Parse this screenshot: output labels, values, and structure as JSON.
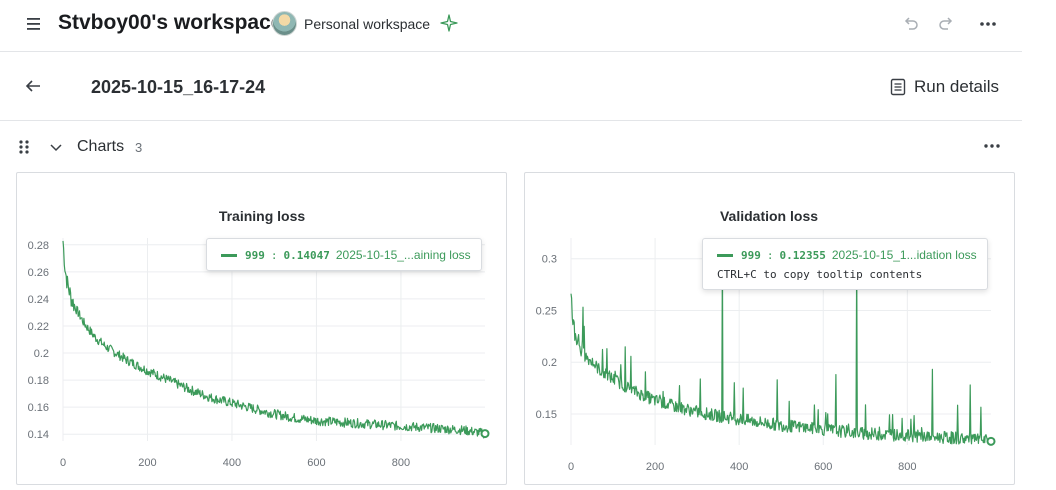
{
  "header": {
    "workspace_title": "Stvboy00's workspace",
    "workspace_name": "Personal workspace"
  },
  "run": {
    "name": "2025-10-15_16-17-24",
    "details_label": "Run details"
  },
  "section": {
    "title": "Charts",
    "count": "3"
  },
  "colors": {
    "series": "#3c9a5a",
    "grid": "#eceef0",
    "axis": "#6b7178"
  },
  "charts": [
    {
      "title": "Training loss",
      "tooltip": {
        "step": "999",
        "value": "0.14047",
        "label": "2025-10-15_...aining loss"
      }
    },
    {
      "title": "Validation loss",
      "tooltip": {
        "step": "999",
        "value": "0.12355",
        "label": "2025-10-15_1...idation loss",
        "hint": "CTRL+C to copy tooltip contents"
      }
    }
  ],
  "chart_data": [
    {
      "type": "line",
      "title": "Training loss",
      "xlabel": "",
      "ylabel": "",
      "xlim": [
        0,
        999
      ],
      "ylim": [
        0.135,
        0.285
      ],
      "xticks": [
        0,
        200,
        400,
        600,
        800
      ],
      "yticks": [
        0.14,
        0.16,
        0.18,
        0.2,
        0.22,
        0.24,
        0.26,
        0.28
      ],
      "grid": true,
      "series": [
        {
          "x": [
            0,
            5,
            10,
            20,
            30,
            50,
            75,
            100,
            150,
            200,
            250,
            300,
            350,
            400,
            450,
            500,
            550,
            600,
            650,
            700,
            750,
            800,
            850,
            900,
            950,
            999
          ],
          "values": [
            0.283,
            0.262,
            0.252,
            0.24,
            0.233,
            0.222,
            0.212,
            0.205,
            0.195,
            0.187,
            0.18,
            0.173,
            0.167,
            0.163,
            0.159,
            0.155,
            0.152,
            0.15,
            0.149,
            0.148,
            0.147,
            0.146,
            0.145,
            0.144,
            0.143,
            0.14047
          ]
        }
      ]
    },
    {
      "type": "line",
      "title": "Validation loss",
      "xlabel": "",
      "ylabel": "",
      "xlim": [
        0,
        999
      ],
      "ylim": [
        0.12,
        0.32
      ],
      "xticks": [
        0,
        200,
        400,
        600,
        800
      ],
      "yticks": [
        0.15,
        0.2,
        0.25,
        0.3
      ],
      "grid": true,
      "series": [
        {
          "x": [
            0,
            5,
            10,
            20,
            30,
            50,
            75,
            100,
            150,
            200,
            250,
            300,
            350,
            400,
            450,
            500,
            550,
            600,
            650,
            700,
            750,
            800,
            850,
            900,
            950,
            999
          ],
          "values": [
            0.27,
            0.238,
            0.228,
            0.218,
            0.208,
            0.2,
            0.19,
            0.184,
            0.172,
            0.163,
            0.157,
            0.152,
            0.148,
            0.145,
            0.142,
            0.139,
            0.137,
            0.135,
            0.133,
            0.131,
            0.13,
            0.129,
            0.128,
            0.127,
            0.126,
            0.12355
          ]
        }
      ],
      "spikes": [
        {
          "x": 360,
          "value": 0.305
        },
        {
          "x": 680,
          "value": 0.305
        },
        {
          "x": 630,
          "value": 0.188
        },
        {
          "x": 410,
          "value": 0.175
        },
        {
          "x": 490,
          "value": 0.183
        },
        {
          "x": 860,
          "value": 0.193
        },
        {
          "x": 950,
          "value": 0.178
        }
      ]
    }
  ]
}
